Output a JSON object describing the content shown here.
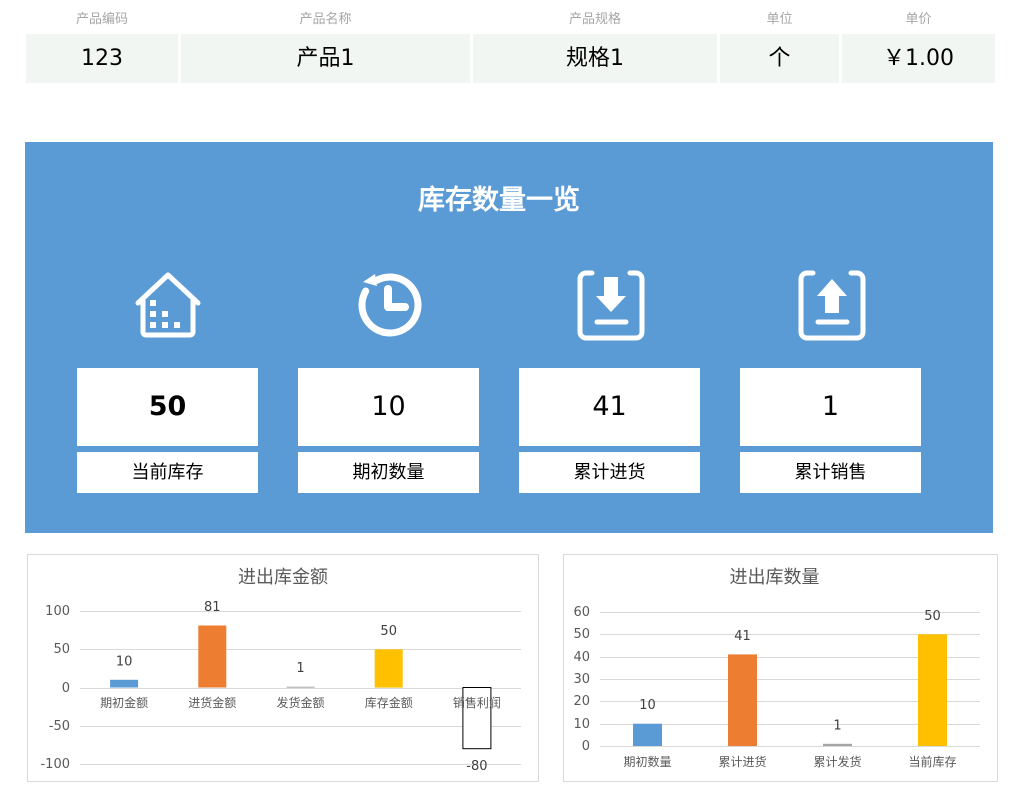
{
  "product": {
    "headers": [
      "产品编码",
      "产品名称",
      "产品规格",
      "单位",
      "单价"
    ],
    "values": [
      "123",
      "产品1",
      "规格1",
      "个",
      "￥1.00"
    ]
  },
  "inventory": {
    "title": "库存数量一览",
    "cards": [
      {
        "icon": "house-icon",
        "value": "50",
        "label": "当前库存"
      },
      {
        "icon": "clock-icon",
        "value": "10",
        "label": "期初数量"
      },
      {
        "icon": "download-icon",
        "value": "41",
        "label": "累计进货"
      },
      {
        "icon": "upload-icon",
        "value": "1",
        "label": "累计销售"
      }
    ]
  },
  "theme": {
    "panel_bg": "#5b9bd5",
    "cell_bg": "#f2f6f2",
    "panel_text": "#ffffff"
  },
  "chart_data": [
    {
      "type": "bar",
      "title": "进出库金额",
      "categories": [
        "期初金额",
        "进货金额",
        "发货金额",
        "库存金额",
        "销售利润"
      ],
      "values": [
        10,
        81,
        1,
        50,
        -80
      ],
      "ylim": [
        -100,
        100
      ],
      "yticks": [
        -100,
        -50,
        0,
        50,
        100
      ],
      "bar_colors": [
        "#5b9bd5",
        "#ed7d31",
        "#a5a5a5",
        "#ffc000",
        "#ffffff"
      ],
      "bar_outline": [
        null,
        null,
        null,
        null,
        "#000000"
      ],
      "data_labels": true,
      "grid": true
    },
    {
      "type": "bar",
      "title": "进出库数量",
      "categories": [
        "期初数量",
        "累计进货",
        "累计发货",
        "当前库存"
      ],
      "values": [
        10,
        41,
        1,
        50
      ],
      "ylim": [
        0,
        60
      ],
      "yticks": [
        0,
        10,
        20,
        30,
        40,
        50,
        60
      ],
      "bar_colors": [
        "#5b9bd5",
        "#ed7d31",
        "#a5a5a5",
        "#ffc000"
      ],
      "data_labels": true,
      "grid": true
    }
  ]
}
